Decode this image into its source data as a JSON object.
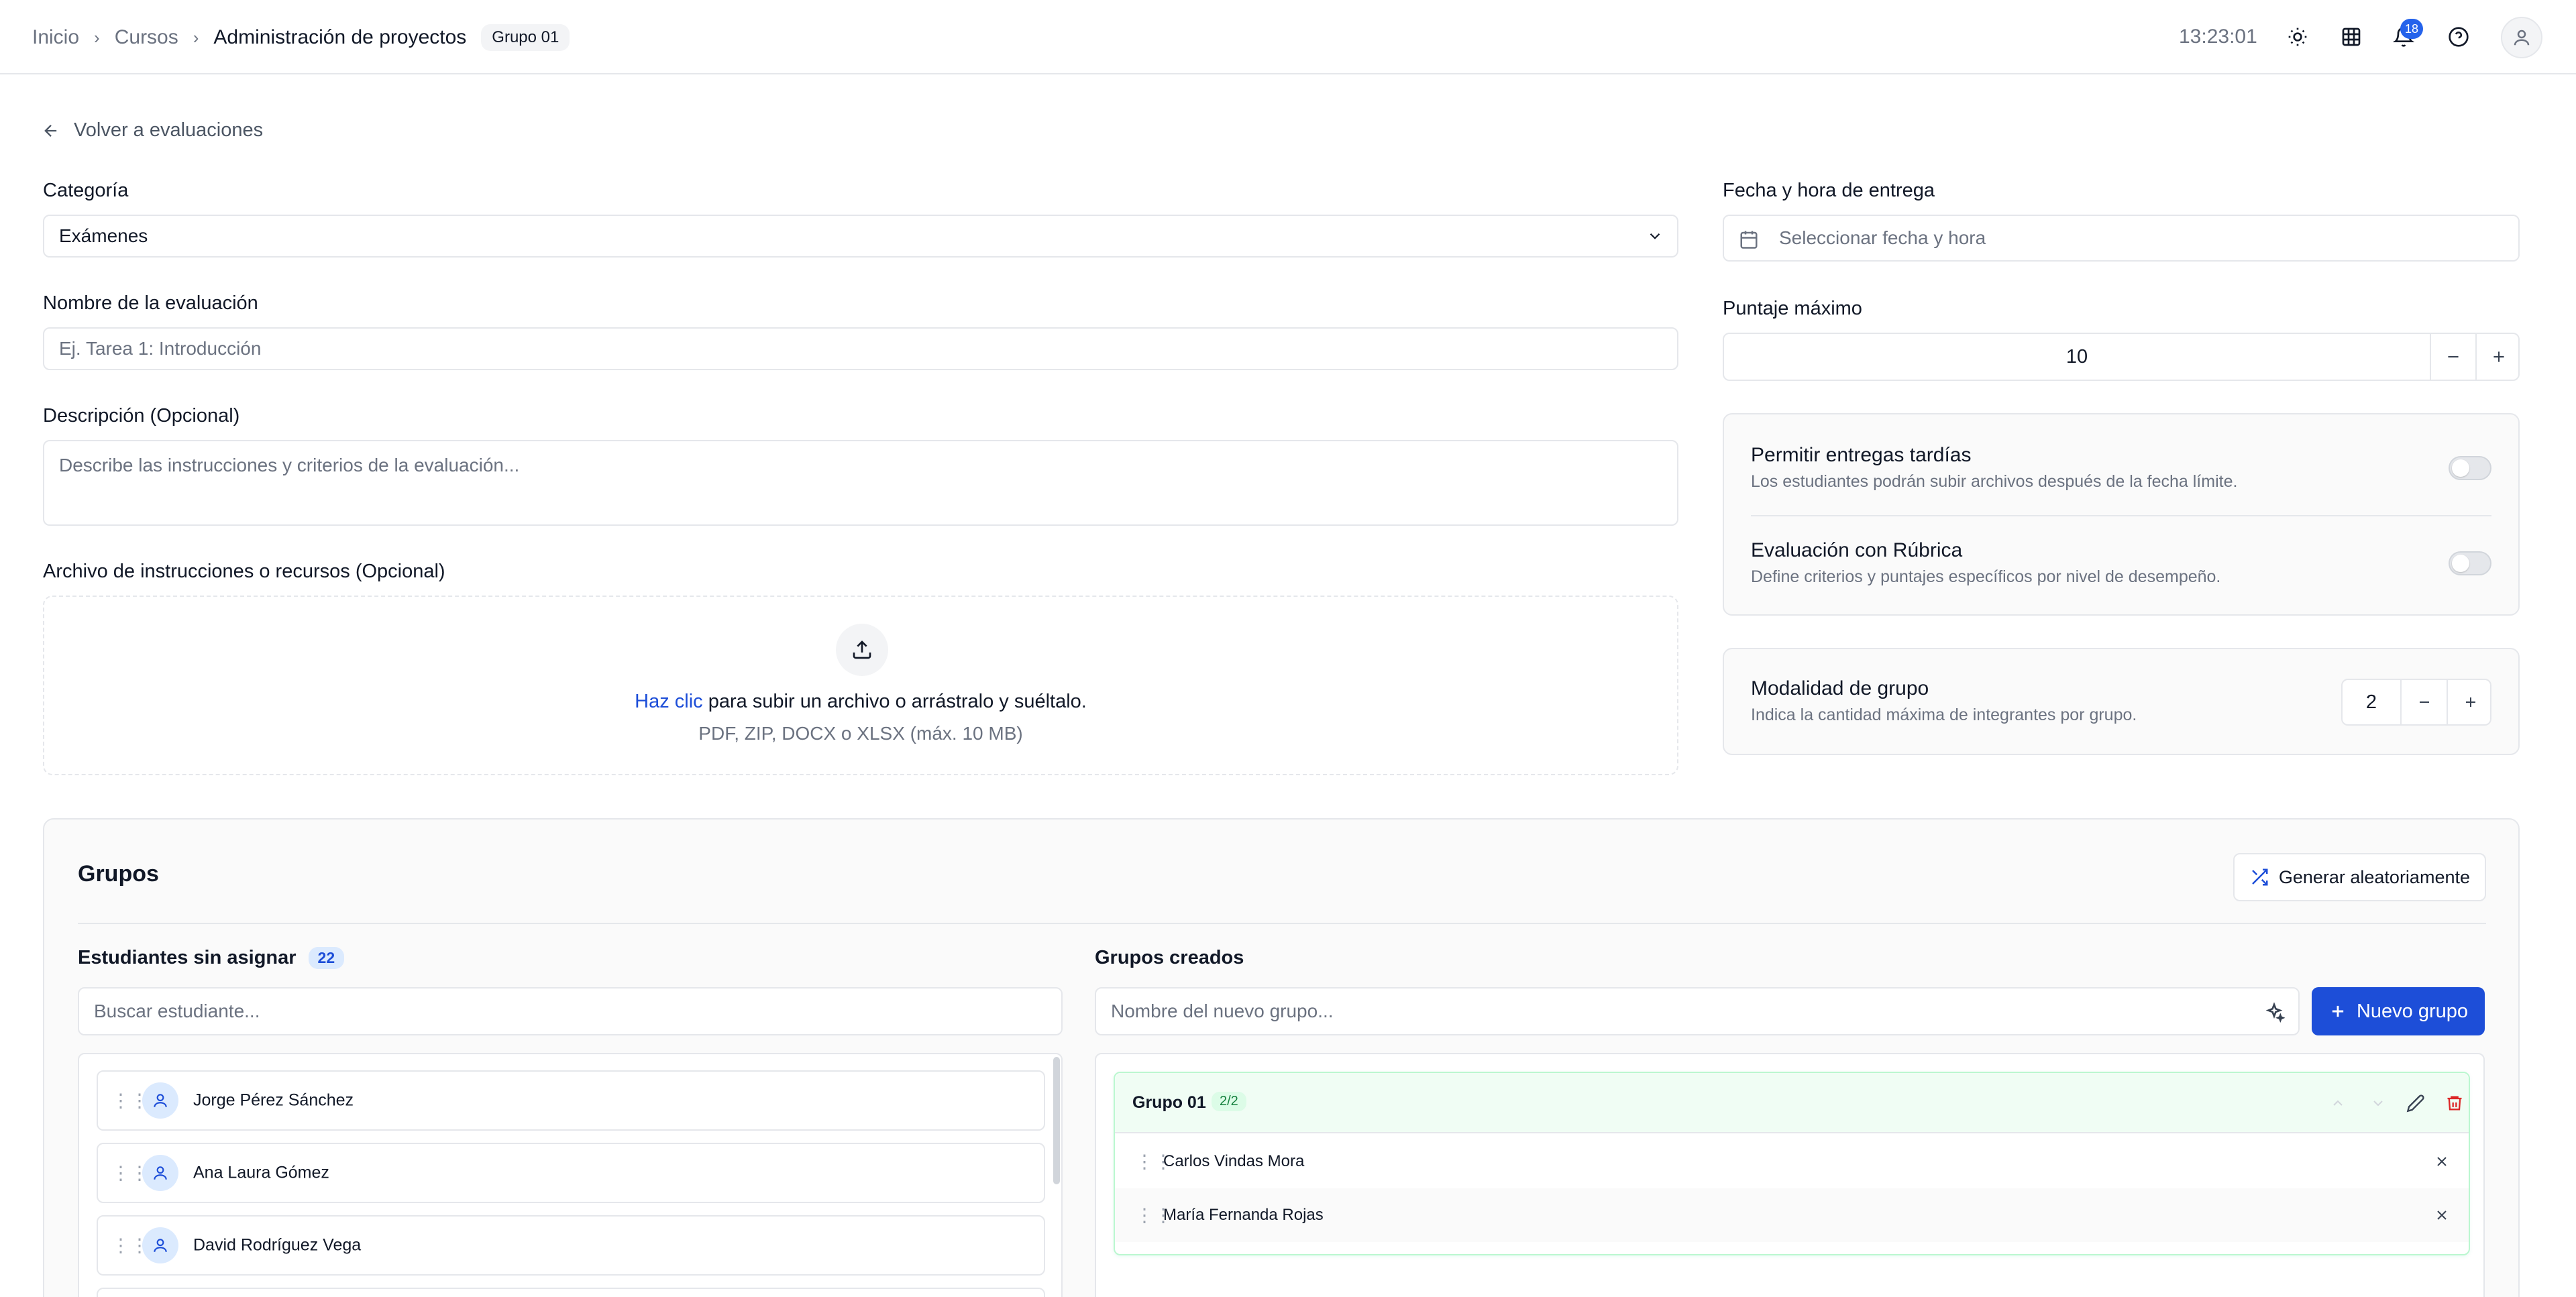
{
  "breadcrumb": {
    "items": [
      "Inicio",
      "Cursos",
      "Administración de proyectos"
    ],
    "badge": "Grupo 01"
  },
  "header": {
    "time": "13:23:01",
    "notifications_count": "18"
  },
  "back_link": "Volver a evaluaciones",
  "form": {
    "category_label": "Categoría",
    "category_value": "Exámenes",
    "name_label": "Nombre de la evaluación",
    "name_placeholder": "Ej. Tarea 1: Introducción",
    "description_label": "Descripción (Opcional)",
    "description_placeholder": "Describe las instrucciones y criterios de la evaluación...",
    "file_label": "Archivo de instrucciones o recursos (Opcional)",
    "upload_link": "Haz clic",
    "upload_text": " para subir un archivo o arrástralo y suéltalo.",
    "upload_formats": "PDF, ZIP, DOCX o XLSX (máx. 10 MB)"
  },
  "right": {
    "due_label": "Fecha y hora de entrega",
    "due_placeholder": "Seleccionar fecha y hora",
    "max_score_label": "Puntaje máximo",
    "max_score_value": "10",
    "late_title": "Permitir entregas tardías",
    "late_desc": "Los estudiantes podrán subir archivos después de la fecha límite.",
    "late_enabled": false,
    "rubric_title": "Evaluación con Rúbrica",
    "rubric_desc": "Define criterios y puntajes específicos por nivel de desempeño.",
    "rubric_enabled": false,
    "group_mode_title": "Modalidad de grupo",
    "group_mode_desc": "Indica la cantidad máxima de integrantes por grupo.",
    "group_mode_value": "2"
  },
  "groups": {
    "title": "Grupos",
    "generate_label": "Generar aleatoriamente",
    "unassigned_title": "Estudiantes sin asignar",
    "unassigned_count": "22",
    "search_placeholder": "Buscar estudiante...",
    "students": [
      "Jorge Pérez Sánchez",
      "Ana Laura Gómez",
      "David Rodríguez Vega"
    ],
    "created_title": "Grupos creados",
    "new_group_placeholder": "Nombre del nuevo grupo...",
    "new_group_button": "Nuevo grupo",
    "group_cards": [
      {
        "name": "Grupo 01",
        "capacity": "2/2",
        "members": [
          "Carlos Vindas Mora",
          "María Fernanda Rojas"
        ]
      }
    ]
  },
  "colors": {
    "accent": "#1d4ed8",
    "success_bg": "#f0fdf4",
    "danger": "#dc2626"
  }
}
